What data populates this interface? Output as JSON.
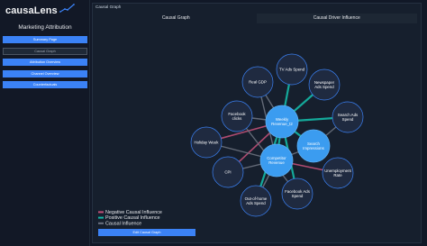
{
  "brand": {
    "name_part1": "causa",
    "name_part2": "Lens"
  },
  "sidebar": {
    "title": "Marketing Attribution",
    "items": [
      {
        "label": "Summary Page"
      },
      {
        "label": "Causal Graph"
      },
      {
        "label": "Attribution Overview"
      },
      {
        "label": "Channel Overview"
      },
      {
        "label": "Counterfactuals"
      }
    ]
  },
  "panel": {
    "title": "Causal Graph",
    "tabs": [
      {
        "label": "Causal Graph"
      },
      {
        "label": "Causal Driver Influence"
      }
    ],
    "edit_button": "Edit Causal Graph"
  },
  "graph": {
    "nodes": [
      {
        "id": "tv",
        "label_lines": [
          "TV Ads Spend"
        ],
        "type": "spend"
      },
      {
        "id": "gdp",
        "label_lines": [
          "Real GDP"
        ],
        "type": "spend"
      },
      {
        "id": "news",
        "label_lines": [
          "Newspaper",
          "Ads Spend"
        ],
        "type": "spend"
      },
      {
        "id": "fbclicks",
        "label_lines": [
          "Facebook",
          "clicks"
        ],
        "type": "spend"
      },
      {
        "id": "revenue",
        "label_lines": [
          "Weekly",
          "Revenue_t2"
        ],
        "type": "key"
      },
      {
        "id": "search",
        "label_lines": [
          "Search Ads",
          "Spend"
        ],
        "type": "spend"
      },
      {
        "id": "holiday",
        "label_lines": [
          "Holiday Week"
        ],
        "type": "spend"
      },
      {
        "id": "impressions",
        "label_lines": [
          "Search",
          "Impressions"
        ],
        "type": "key"
      },
      {
        "id": "cpi",
        "label_lines": [
          "CPI"
        ],
        "type": "spend"
      },
      {
        "id": "competitor",
        "label_lines": [
          "Competitor",
          "Revenue"
        ],
        "type": "key"
      },
      {
        "id": "unemployment",
        "label_lines": [
          "Unemployment",
          "Rate"
        ],
        "type": "spend"
      },
      {
        "id": "ooh",
        "label_lines": [
          "Out-of-home",
          "Ads Spend"
        ],
        "type": "spend"
      },
      {
        "id": "fbspend",
        "label_lines": [
          "Facebook Ads",
          "Spend"
        ],
        "type": "spend"
      }
    ],
    "edges": [
      {
        "from": "tv",
        "to": "revenue",
        "kind": "positive"
      },
      {
        "from": "news",
        "to": "revenue",
        "kind": "positive"
      },
      {
        "from": "search",
        "to": "revenue",
        "kind": "positive"
      },
      {
        "from": "gdp",
        "to": "revenue",
        "kind": "causal"
      },
      {
        "from": "fbclicks",
        "to": "revenue",
        "kind": "causal"
      },
      {
        "from": "impressions",
        "to": "revenue",
        "kind": "positive"
      },
      {
        "from": "competitor",
        "to": "revenue",
        "kind": "positive"
      },
      {
        "from": "holiday",
        "to": "revenue",
        "kind": "negative"
      },
      {
        "from": "cpi",
        "to": "revenue",
        "kind": "negative"
      },
      {
        "from": "fbspend",
        "to": "revenue",
        "kind": "positive"
      },
      {
        "from": "ooh",
        "to": "revenue",
        "kind": "positive"
      },
      {
        "from": "search",
        "to": "impressions",
        "kind": "causal"
      },
      {
        "from": "fbspend",
        "to": "fbclicks",
        "kind": "causal"
      },
      {
        "from": "holiday",
        "to": "competitor",
        "kind": "causal"
      },
      {
        "from": "cpi",
        "to": "competitor",
        "kind": "causal"
      },
      {
        "from": "unemployment",
        "to": "competitor",
        "kind": "negative"
      },
      {
        "from": "gdp",
        "to": "competitor",
        "kind": "causal"
      },
      {
        "from": "ooh",
        "to": "competitor",
        "kind": "causal"
      },
      {
        "from": "impressions",
        "to": "competitor",
        "kind": "causal"
      }
    ],
    "legend": [
      {
        "label": "Negative Causal Influence",
        "color": "#c05078"
      },
      {
        "label": "Positive Causal Influence",
        "color": "#14b8a6"
      },
      {
        "label": "Causal Influence",
        "color": "#6b7280"
      }
    ]
  },
  "colors": {
    "accent": "#3b82f6",
    "key_node": "#3b9cf0",
    "node": "#1f2a40",
    "node_border": "#3b82f6",
    "positive": "#14b8a6",
    "negative": "#c05078",
    "neutral": "#6b7280"
  }
}
